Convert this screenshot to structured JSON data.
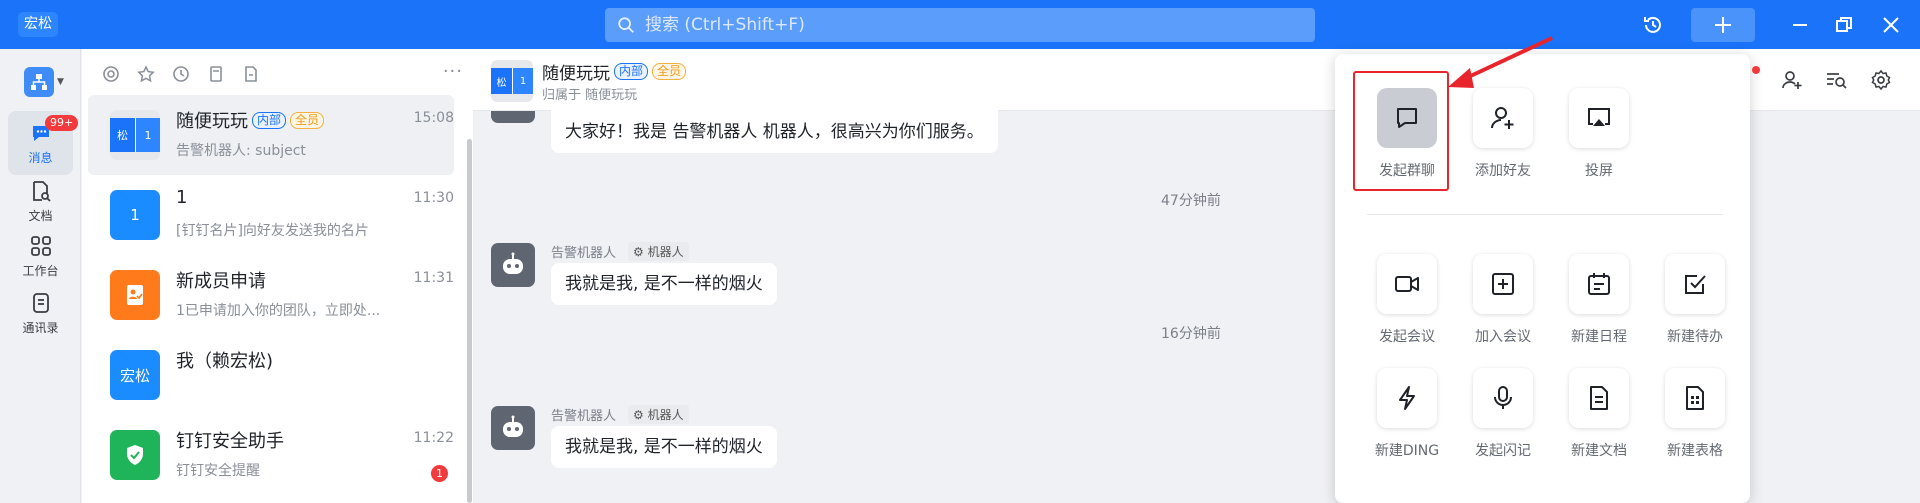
{
  "app": {
    "logo_text": "宏松"
  },
  "search": {
    "placeholder": "搜索 (Ctrl+Shift+F)"
  },
  "leftnav": {
    "badge": "99+",
    "items": [
      {
        "label": "消息",
        "icon": "message-icon"
      },
      {
        "label": "文档",
        "icon": "document-icon"
      },
      {
        "label": "工作台",
        "icon": "workbench-icon"
      },
      {
        "label": "通讯录",
        "icon": "contacts-icon"
      }
    ]
  },
  "conversations": [
    {
      "name": "随便玩玩",
      "tags": [
        "内部",
        "全员"
      ],
      "preview": "告警机器人: subject",
      "time": "15:08",
      "avatar_left": "松",
      "avatar_right": "1"
    },
    {
      "name": "1",
      "preview": "[钉钉名片]向好友发送我的名片",
      "time": "11:30",
      "avatar_text": "1",
      "avatar_color": "#1a8cff"
    },
    {
      "name": "新成员申请",
      "preview": "1已申请加入你的团队，立即处...",
      "time": "11:31",
      "avatar_color": "#ff7a1a"
    },
    {
      "name": "我（赖宏松)",
      "preview": "",
      "time": "",
      "avatar_text": "宏松",
      "avatar_color": "#1a8cff"
    },
    {
      "name": "钉钉安全助手",
      "preview": "钉钉安全提醒",
      "time": "11:22",
      "unread": "1",
      "avatar_color": "#1fb45a"
    }
  ],
  "chat": {
    "title": "随便玩玩",
    "tags": [
      "内部",
      "全员"
    ],
    "subtitle": "归属于 随便玩玩",
    "avatar_left": "松",
    "avatar_right": "1",
    "messages": [
      {
        "text": "大家好！我是 告警机器人 机器人，很高兴为你们服务。"
      },
      {
        "time_sep": "47分钟前"
      },
      {
        "sender": "告警机器人",
        "role": "机器人",
        "text": "我就是我, 是不一样的烟火"
      },
      {
        "time_sep": "16分钟前"
      },
      {
        "sender": "告警机器人",
        "role": "机器人",
        "text": "我就是我, 是不一样的烟火"
      }
    ]
  },
  "popup": {
    "top_items": [
      {
        "label": "发起群聊",
        "icon": "group-chat-icon",
        "selected": true
      },
      {
        "label": "添加好友",
        "icon": "add-friend-icon"
      },
      {
        "label": "投屏",
        "icon": "screencast-icon"
      }
    ],
    "grid_items": [
      {
        "label": "发起会议",
        "icon": "video-meeting-icon"
      },
      {
        "label": "加入会议",
        "icon": "join-meeting-icon"
      },
      {
        "label": "新建日程",
        "icon": "calendar-icon"
      },
      {
        "label": "新建待办",
        "icon": "todo-icon"
      },
      {
        "label": "新建DING",
        "icon": "ding-icon"
      },
      {
        "label": "发起闪记",
        "icon": "flash-note-icon"
      },
      {
        "label": "新建文档",
        "icon": "new-doc-icon"
      },
      {
        "label": "新建表格",
        "icon": "new-sheet-icon"
      }
    ]
  },
  "colors": {
    "brand": "#1a73f8",
    "annotation": "#e8242c"
  }
}
